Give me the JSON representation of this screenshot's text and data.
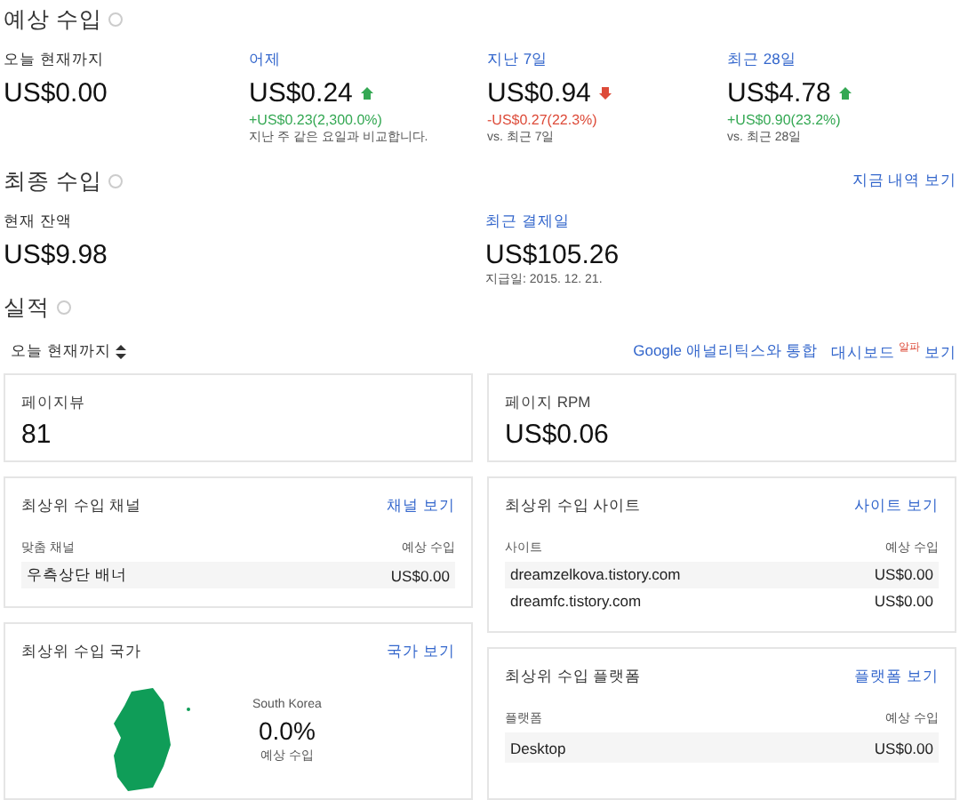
{
  "estimated": {
    "title": "예상 수입",
    "metrics": [
      {
        "label": "오늘 현재까지",
        "link": false,
        "value": "US$0.00"
      },
      {
        "label": "어제",
        "link": true,
        "value": "US$0.24",
        "kind": "up",
        "change": "+US$0.23(2,300.0%)",
        "note": "지난 주 같은 요일과 비교합니다."
      },
      {
        "label": "지난 7일",
        "link": true,
        "value": "US$0.94",
        "kind": "down",
        "change": "-US$0.27(22.3%)",
        "note": "vs. 최근 7일"
      },
      {
        "label": "최근 28일",
        "link": true,
        "value": "US$4.78",
        "kind": "up",
        "change": "+US$0.90(23.2%)",
        "note": "vs. 최근 28일"
      }
    ]
  },
  "finalized": {
    "title": "최종 수입",
    "link": "지금 내역 보기",
    "balance": {
      "label": "현재 잔액",
      "value": "US$9.98"
    },
    "last_payment": {
      "label": "최근 결제일",
      "value": "US$105.26",
      "note": "지급일: 2015. 12. 21."
    }
  },
  "performance": {
    "title": "실적",
    "range": "오늘 현재까지",
    "analytics_link": "Google 애널리틱스와 통합",
    "dashboard_link": "대시보드",
    "badge": "알파",
    "view_link": "보기",
    "kpis": [
      {
        "label": "페이지뷰",
        "value": "81"
      },
      {
        "label": "페이지 RPM",
        "value": "US$0.06"
      }
    ],
    "channels": {
      "title": "최상위 수입 채널",
      "link": "채널 보기",
      "columns": [
        "맞춤 채널",
        "예상 수입"
      ],
      "rows": [
        [
          "우측상단 배너",
          "US$0.00"
        ]
      ]
    },
    "sites": {
      "title": "최상위 수입 사이트",
      "link": "사이트 보기",
      "columns": [
        "사이트",
        "예상 수입"
      ],
      "rows": [
        [
          "dreamzelkova.tistory.com",
          "US$0.00"
        ],
        [
          "dreamfc.tistory.com",
          "US$0.00"
        ]
      ]
    },
    "countries": {
      "title": "최상위 수입 국가",
      "link": "국가 보기",
      "country": "South Korea",
      "share": "0.0%",
      "share_label": "예상 수입"
    },
    "platforms": {
      "title": "최상위 수입 플랫폼",
      "link": "플랫폼 보기",
      "columns": [
        "플랫폼",
        "예상 수입"
      ],
      "rows": [
        [
          "Desktop",
          "US$0.00"
        ]
      ]
    }
  }
}
